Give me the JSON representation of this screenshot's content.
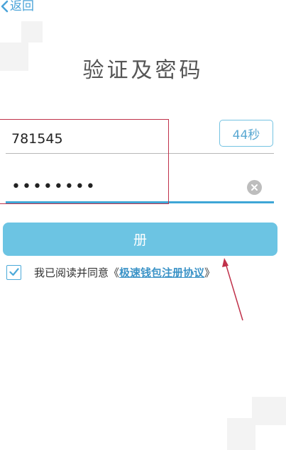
{
  "nav": {
    "back_label": "返回"
  },
  "page": {
    "title": "验证及密码"
  },
  "verification": {
    "code_value": "781545",
    "countdown_label": "44秒"
  },
  "password": {
    "masked_value": "••••••••"
  },
  "register": {
    "label": "册"
  },
  "agreement": {
    "checked": true,
    "prefix": "我已阅读并同意《",
    "link_label": "极速钱包注册协议",
    "suffix": "》"
  },
  "colors": {
    "accent": "#6cc4e3",
    "link": "#3b93c7",
    "annotation": "#c0314a"
  },
  "icons": {
    "back": "chevron-left-icon",
    "clear": "close-circle-icon",
    "check": "checkmark-icon"
  }
}
